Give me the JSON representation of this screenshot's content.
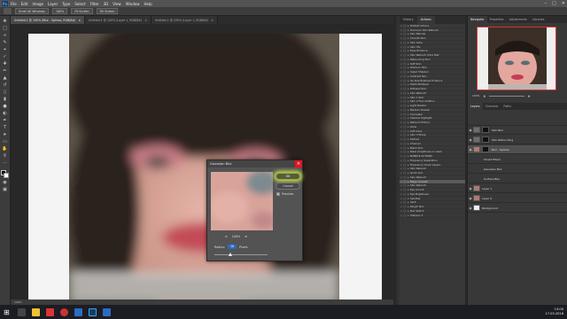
{
  "menubar": {
    "logo": "Ps",
    "items": [
      "File",
      "Edit",
      "Image",
      "Layer",
      "Type",
      "Select",
      "Filter",
      "3D",
      "View",
      "Window",
      "Help"
    ]
  },
  "optionbar": {
    "buttons": [
      "Scroll All Windows",
      "100%",
      "Fit Screen",
      "Fill Screen"
    ]
  },
  "tabs": [
    {
      "label": "Untitled-1 @ 100% (Blur - Splines, RGB/8#)",
      "active": true
    },
    {
      "label": "Untitled-1 @ 100% (Layer 1, RGB/8#)",
      "active": false
    },
    {
      "label": "Untitled-1 @ 100% (Layer 1, RGB/8#)",
      "active": false
    }
  ],
  "status": {
    "zoom": "100%"
  },
  "dialog": {
    "title": "Gaussian Blur",
    "ok": "OK",
    "cancel": "Cancel",
    "preview_label": "Preview",
    "preview_checked": true,
    "zoom": "100%",
    "radius_label": "Radius:",
    "radius_value": "10",
    "radius_unit": "Pixels",
    "radius_fraction": 0.3
  },
  "actions_panel": {
    "tabs": [
      "History",
      "Actions"
    ],
    "items": [
      "Default Actions",
      "Tuscanoo Skin Retouch",
      "Skin Blender",
      "Smooth Skin",
      "Skin Glow",
      "Skin Vfx",
      "Eyes Enhance",
      "Skin Retouch Ultra Fast",
      "Retouching Skin",
      "Soft Skin",
      "Glamour Skin",
      "Super Sharpen",
      "Contrast Skin",
      "Up Size Eyebrow Enhance",
      "Teeth Whitener",
      "Diffused Skin",
      "Skin Retouch",
      "Skin 1 Skin",
      "Skin 2 Fine Addition",
      "Light Powder",
      "Medium Powder",
      "Concealer",
      "Shadow Highlight",
      "Retouch Picture",
      "Glow",
      "Soft Glow",
      "Skin 3 Sharp",
      "Texture",
      "Channel",
      "Black Skin",
      "Mask (brightness in clear)",
      "BUNDLE ACTIONS",
      "Frequency Separation",
      "Frequency Check Layers",
      "Skin Retouch",
      "Quick skin",
      "Skin Retouch",
      "Magic Smooth",
      "Skin Retouch",
      "Eye Accent",
      "Eye Brightness",
      "Sandbel",
      "Sprit",
      "Rough Skin",
      "Rod Sketch",
      "Sharpen 2"
    ],
    "selected_index": 37
  },
  "navigator": {
    "tabs": [
      "Navigator",
      "Properties",
      "Adjustments",
      "Libraries"
    ],
    "zoom": "100%"
  },
  "layers_top": {
    "tabs": [
      "Layers",
      "Paths"
    ]
  },
  "layers_panel": {
    "tabs": [
      "Layers",
      "Channels",
      "Paths"
    ],
    "rows": [
      {
        "name": "Skin Blur",
        "type": "group"
      },
      {
        "name": "Skin Retouching",
        "type": "group"
      },
      {
        "name": "Blur - Splines",
        "type": "layer",
        "selected": true
      },
      {
        "name": "Smart Filters",
        "type": "effect"
      },
      {
        "name": "Gaussian Blur",
        "type": "effect"
      },
      {
        "name": "Surface Blur",
        "type": "effect"
      },
      {
        "name": "Layer 1",
        "type": "layer"
      },
      {
        "name": "Layer 0",
        "type": "layer"
      },
      {
        "name": "Background",
        "type": "layer"
      }
    ]
  },
  "taskbar": {
    "time": "13:00",
    "date": "17.03.2018"
  },
  "colors": {
    "accent": "#31a8ff",
    "close": "#e81123",
    "ok_glow": "#c9e24a"
  }
}
